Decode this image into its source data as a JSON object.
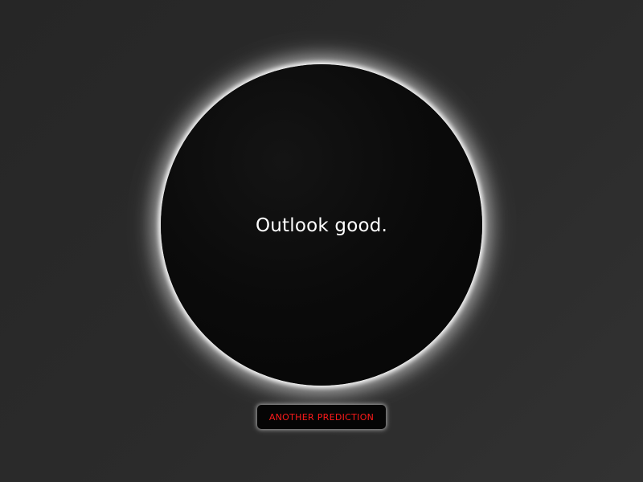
{
  "orb": {
    "answer": "Outlook good."
  },
  "actions": {
    "another_prediction_label": "ANOTHER PREDICTION"
  },
  "colors": {
    "background": "#2b2b2b",
    "orb_fill": "#0b0b0b",
    "orb_glow": "#ffffff",
    "answer_text": "#ffffff",
    "button_background": "#050505",
    "button_text": "#ff1a1a"
  }
}
